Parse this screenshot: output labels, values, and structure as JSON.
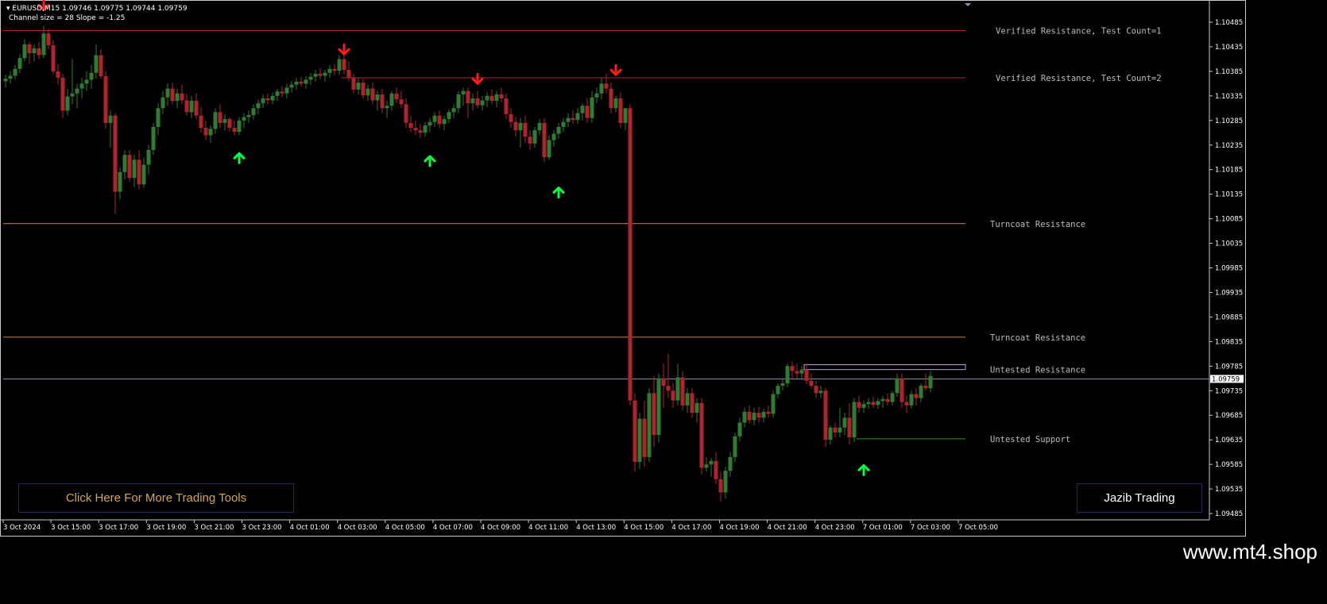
{
  "header": {
    "symbol_line": "EURUSD,M15  1.09746 1.09775 1.09744 1.09759",
    "channel_line": "Channel size = 28 Slope = -1.25"
  },
  "buttons": {
    "tools": "Click Here For More Trading Tools",
    "brand": "Jazib Trading"
  },
  "watermark": "www.mt4.shop",
  "colors": {
    "background": "#000000",
    "bull": "#2e7d32",
    "bear": "#b0232f",
    "arrow_up": "#00ff3c",
    "arrow_down": "#ff1a1a",
    "verified_resistance": "#b0232f",
    "turncoat": "#c8844a",
    "untested_resistance": "#b9a3d8",
    "untested_support": "#3a8a3a",
    "bid_line": "#8892b0"
  },
  "chart_data": {
    "type": "candlestick",
    "symbol": "EURUSD",
    "timeframe": "M15",
    "current_price": "1.09759",
    "y_ticks": [
      "1.10485",
      "1.10435",
      "1.10385",
      "1.10335",
      "1.10285",
      "1.10235",
      "1.10185",
      "1.10135",
      "1.10085",
      "1.10035",
      "1.09985",
      "1.09935",
      "1.09885",
      "1.09835",
      "1.09785",
      "1.09735",
      "1.09685",
      "1.09635",
      "1.09585",
      "1.09535",
      "1.09485"
    ],
    "x_ticks": [
      "3 Oct 2024",
      "3 Oct 15:00",
      "3 Oct 17:00",
      "3 Oct 19:00",
      "3 Oct 21:00",
      "3 Oct 23:00",
      "4 Oct 01:00",
      "4 Oct 03:00",
      "4 Oct 05:00",
      "4 Oct 07:00",
      "4 Oct 09:00",
      "4 Oct 11:00",
      "4 Oct 13:00",
      "4 Oct 15:00",
      "4 Oct 17:00",
      "4 Oct 19:00",
      "4 Oct 21:00",
      "4 Oct 23:00",
      "7 Oct 01:00",
      "7 Oct 03:00",
      "7 Oct 05:00"
    ],
    "zones": [
      {
        "label": "Verified Resistance, Test Count=1",
        "price": 1.10468,
        "kind": "verified",
        "start_bar": 0
      },
      {
        "label": "Verified Resistance, Test Count=2",
        "price": 1.10372,
        "kind": "verified",
        "start_bar": 71
      },
      {
        "label": "Turncoat Resistance",
        "price": 1.10075,
        "kind": "turncoat",
        "start_bar": 0
      },
      {
        "label": "Turncoat Resistance",
        "price": 1.09844,
        "kind": "turncoat",
        "start_bar": 0
      },
      {
        "label": "Untested Resistance",
        "price": 1.09778,
        "kind": "untested_res",
        "start_bar": 168,
        "top": 1.09788,
        "bottom": 1.09778
      },
      {
        "label": "Untested Support",
        "price": 1.09637,
        "kind": "untested_sup",
        "start_bar": 179
      }
    ],
    "arrows": [
      {
        "bar": 8,
        "dir": "down",
        "price": 1.1051
      },
      {
        "bar": 49,
        "dir": "up",
        "price": 1.10218
      },
      {
        "bar": 71,
        "dir": "down",
        "price": 1.1042
      },
      {
        "bar": 89,
        "dir": "up",
        "price": 1.10212
      },
      {
        "bar": 99,
        "dir": "down",
        "price": 1.1036
      },
      {
        "bar": 116,
        "dir": "up",
        "price": 1.10148
      },
      {
        "bar": 128,
        "dir": "down",
        "price": 1.10378
      },
      {
        "bar": 180,
        "dir": "up",
        "price": 1.09583
      }
    ],
    "candles": [
      [
        1.10365,
        1.10378,
        1.10352,
        1.1037
      ],
      [
        1.1037,
        1.10385,
        1.1036,
        1.10376
      ],
      [
        1.10376,
        1.10398,
        1.10368,
        1.1039
      ],
      [
        1.1039,
        1.1042,
        1.10382,
        1.10412
      ],
      [
        1.10412,
        1.1045,
        1.10405,
        1.1044
      ],
      [
        1.1044,
        1.10445,
        1.104,
        1.10422
      ],
      [
        1.10422,
        1.1044,
        1.10405,
        1.10432
      ],
      [
        1.10432,
        1.10445,
        1.1041,
        1.10418
      ],
      [
        1.10418,
        1.10478,
        1.10412,
        1.10462
      ],
      [
        1.10462,
        1.10472,
        1.1043,
        1.10438
      ],
      [
        1.10438,
        1.10448,
        1.1038,
        1.10385
      ],
      [
        1.10385,
        1.104,
        1.10358,
        1.10372
      ],
      [
        1.10372,
        1.1038,
        1.1029,
        1.10305
      ],
      [
        1.10305,
        1.1035,
        1.10295,
        1.10334
      ],
      [
        1.10334,
        1.1041,
        1.10318,
        1.1034
      ],
      [
        1.1034,
        1.1036,
        1.1031,
        1.1035
      ],
      [
        1.1035,
        1.10372,
        1.1033,
        1.1036
      ],
      [
        1.1036,
        1.10385,
        1.10345,
        1.10368
      ],
      [
        1.10368,
        1.10398,
        1.1035,
        1.10382
      ],
      [
        1.10382,
        1.1044,
        1.1037,
        1.10418
      ],
      [
        1.10418,
        1.1043,
        1.1037,
        1.10375
      ],
      [
        1.10375,
        1.10385,
        1.10268,
        1.1028
      ],
      [
        1.1028,
        1.10305,
        1.1023,
        1.10295
      ],
      [
        1.10295,
        1.103,
        1.10095,
        1.1014
      ],
      [
        1.1014,
        1.1019,
        1.10125,
        1.1018
      ],
      [
        1.1018,
        1.10225,
        1.10165,
        1.10215
      ],
      [
        1.10215,
        1.10225,
        1.1016,
        1.10168
      ],
      [
        1.10168,
        1.10215,
        1.1015,
        1.10205
      ],
      [
        1.10205,
        1.10225,
        1.10145,
        1.10155
      ],
      [
        1.10155,
        1.1021,
        1.10148,
        1.10195
      ],
      [
        1.10195,
        1.10235,
        1.10175,
        1.10225
      ],
      [
        1.10225,
        1.1028,
        1.10215,
        1.10272
      ],
      [
        1.10272,
        1.1032,
        1.10255,
        1.1031
      ],
      [
        1.1031,
        1.10345,
        1.10298,
        1.10332
      ],
      [
        1.10332,
        1.1036,
        1.10315,
        1.1035
      ],
      [
        1.1035,
        1.10362,
        1.10318,
        1.10325
      ],
      [
        1.10325,
        1.1035,
        1.1031,
        1.1034
      ],
      [
        1.1034,
        1.10358,
        1.10318,
        1.10326
      ],
      [
        1.10326,
        1.1034,
        1.10295,
        1.10302
      ],
      [
        1.10302,
        1.10335,
        1.1029,
        1.10325
      ],
      [
        1.10325,
        1.1034,
        1.10288,
        1.10295
      ],
      [
        1.10295,
        1.10312,
        1.1026,
        1.1027
      ],
      [
        1.1027,
        1.10285,
        1.10245,
        1.10255
      ],
      [
        1.10255,
        1.10275,
        1.1024,
        1.10268
      ],
      [
        1.10268,
        1.1031,
        1.10258,
        1.10302
      ],
      [
        1.10302,
        1.10318,
        1.1027,
        1.1028
      ],
      [
        1.1028,
        1.10298,
        1.10265,
        1.10288
      ],
      [
        1.10288,
        1.10292,
        1.10262,
        1.1027
      ],
      [
        1.1027,
        1.10285,
        1.10255,
        1.10262
      ],
      [
        1.10262,
        1.10292,
        1.10255,
        1.10285
      ],
      [
        1.10285,
        1.103,
        1.1027,
        1.10292
      ],
      [
        1.10292,
        1.10305,
        1.1028,
        1.10296
      ],
      [
        1.10296,
        1.10318,
        1.10288,
        1.1031
      ],
      [
        1.1031,
        1.10328,
        1.10298,
        1.1032
      ],
      [
        1.1032,
        1.10338,
        1.1031,
        1.1033
      ],
      [
        1.1033,
        1.1034,
        1.10318,
        1.10326
      ],
      [
        1.10326,
        1.10342,
        1.10318,
        1.10335
      ],
      [
        1.10335,
        1.1035,
        1.10325,
        1.10344
      ],
      [
        1.10344,
        1.10355,
        1.10332,
        1.1034
      ],
      [
        1.1034,
        1.1036,
        1.1033,
        1.10352
      ],
      [
        1.10352,
        1.10365,
        1.10342,
        1.10358
      ],
      [
        1.10358,
        1.10372,
        1.10348,
        1.10364
      ],
      [
        1.10364,
        1.10374,
        1.10354,
        1.1036
      ],
      [
        1.1036,
        1.10375,
        1.1035,
        1.10368
      ],
      [
        1.10368,
        1.10382,
        1.10358,
        1.10374
      ],
      [
        1.10374,
        1.10388,
        1.10364,
        1.1038
      ],
      [
        1.1038,
        1.10392,
        1.10368,
        1.10376
      ],
      [
        1.10376,
        1.10388,
        1.10364,
        1.10382
      ],
      [
        1.10382,
        1.10398,
        1.10372,
        1.1039
      ],
      [
        1.1039,
        1.104,
        1.10378,
        1.10386
      ],
      [
        1.10386,
        1.10418,
        1.10378,
        1.1041
      ],
      [
        1.1041,
        1.10425,
        1.1038,
        1.10388
      ],
      [
        1.10388,
        1.10405,
        1.10365,
        1.10372
      ],
      [
        1.10372,
        1.1038,
        1.1034,
        1.10348
      ],
      [
        1.10348,
        1.10372,
        1.10338,
        1.10362
      ],
      [
        1.10362,
        1.1037,
        1.1033,
        1.10336
      ],
      [
        1.10336,
        1.10358,
        1.10325,
        1.1035
      ],
      [
        1.1035,
        1.10362,
        1.10318,
        1.10326
      ],
      [
        1.10326,
        1.10345,
        1.10305,
        1.10338
      ],
      [
        1.10338,
        1.1035,
        1.103,
        1.1031
      ],
      [
        1.1031,
        1.10325,
        1.1029,
        1.10315
      ],
      [
        1.10315,
        1.10345,
        1.10305,
        1.1034
      ],
      [
        1.1034,
        1.10352,
        1.1032,
        1.10328
      ],
      [
        1.10328,
        1.10345,
        1.1031,
        1.10318
      ],
      [
        1.10318,
        1.1033,
        1.1027,
        1.1028
      ],
      [
        1.1028,
        1.10295,
        1.10262,
        1.1027
      ],
      [
        1.1027,
        1.10285,
        1.10255,
        1.10265
      ],
      [
        1.10265,
        1.10278,
        1.1025,
        1.1026
      ],
      [
        1.1026,
        1.10282,
        1.10252,
        1.10275
      ],
      [
        1.10275,
        1.1029,
        1.10262,
        1.10282
      ],
      [
        1.10282,
        1.10302,
        1.10272,
        1.10295
      ],
      [
        1.10295,
        1.10305,
        1.1027,
        1.10278
      ],
      [
        1.10278,
        1.10295,
        1.10265,
        1.10288
      ],
      [
        1.10288,
        1.10308,
        1.1028,
        1.10302
      ],
      [
        1.10302,
        1.10318,
        1.1029,
        1.1031
      ],
      [
        1.1031,
        1.10345,
        1.103,
        1.10338
      ],
      [
        1.10338,
        1.10352,
        1.10315,
        1.10345
      ],
      [
        1.10345,
        1.10352,
        1.1029,
        1.1032
      ],
      [
        1.1032,
        1.1034,
        1.10305,
        1.1033
      ],
      [
        1.1033,
        1.10345,
        1.1031,
        1.10316
      ],
      [
        1.10316,
        1.10335,
        1.10305,
        1.10326
      ],
      [
        1.10326,
        1.10342,
        1.10312,
        1.10335
      ],
      [
        1.10335,
        1.10348,
        1.10318,
        1.10325
      ],
      [
        1.10325,
        1.10345,
        1.10312,
        1.10338
      ],
      [
        1.10338,
        1.10352,
        1.10322,
        1.1033
      ],
      [
        1.1033,
        1.1034,
        1.10288,
        1.10298
      ],
      [
        1.10298,
        1.1031,
        1.1027,
        1.10282
      ],
      [
        1.10282,
        1.10292,
        1.10252,
        1.10265
      ],
      [
        1.10265,
        1.1029,
        1.1023,
        1.1028
      ],
      [
        1.1028,
        1.10295,
        1.1024,
        1.10252
      ],
      [
        1.10252,
        1.10265,
        1.10225,
        1.10238
      ],
      [
        1.10238,
        1.10272,
        1.1023,
        1.10265
      ],
      [
        1.10265,
        1.10288,
        1.10255,
        1.1028
      ],
      [
        1.1028,
        1.1029,
        1.102,
        1.1021
      ],
      [
        1.1021,
        1.10255,
        1.10205,
        1.10245
      ],
      [
        1.10245,
        1.10265,
        1.10232,
        1.10258
      ],
      [
        1.10258,
        1.1028,
        1.10248,
        1.10272
      ],
      [
        1.10272,
        1.1029,
        1.10262,
        1.10282
      ],
      [
        1.10282,
        1.103,
        1.10272,
        1.1029
      ],
      [
        1.1029,
        1.10305,
        1.10278,
        1.10286
      ],
      [
        1.10286,
        1.1031,
        1.10278,
        1.103
      ],
      [
        1.103,
        1.1032,
        1.10285,
        1.10315
      ],
      [
        1.10315,
        1.1033,
        1.1028,
        1.1029
      ],
      [
        1.1029,
        1.10345,
        1.1028,
        1.10332
      ],
      [
        1.10332,
        1.10352,
        1.1032,
        1.1034
      ],
      [
        1.1034,
        1.10372,
        1.10328,
        1.1036
      ],
      [
        1.1036,
        1.1038,
        1.1034,
        1.1035
      ],
      [
        1.1035,
        1.10362,
        1.103,
        1.1031
      ],
      [
        1.1031,
        1.10335,
        1.10302,
        1.1033
      ],
      [
        1.1033,
        1.10342,
        1.1027,
        1.1028
      ],
      [
        1.1028,
        1.1029,
        1.10265,
        1.1031
      ],
      [
        1.1031,
        1.10318,
        1.09705,
        1.09715
      ],
      [
        1.09715,
        1.0973,
        1.0957,
        1.0959
      ],
      [
        1.0959,
        1.0969,
        1.09575,
        1.09678
      ],
      [
        1.09678,
        1.09715,
        1.0958,
        1.096
      ],
      [
        1.096,
        1.0974,
        1.0959,
        1.0973
      ],
      [
        1.0973,
        1.09765,
        1.0962,
        1.09645
      ],
      [
        1.09645,
        1.0977,
        1.0963,
        1.0976
      ],
      [
        1.0976,
        1.0979,
        1.097,
        1.09745
      ],
      [
        1.09745,
        1.0981,
        1.0972,
        1.09735
      ],
      [
        1.09735,
        1.0975,
        1.097,
        1.09715
      ],
      [
        1.09715,
        1.0979,
        1.09705,
        1.09762
      ],
      [
        1.09762,
        1.09775,
        1.09695,
        1.09705
      ],
      [
        1.09705,
        1.0974,
        1.0969,
        1.0973
      ],
      [
        1.0973,
        1.0974,
        1.0968,
        1.0969
      ],
      [
        1.0969,
        1.0972,
        1.0967,
        1.0971
      ],
      [
        1.0971,
        1.0972,
        1.09565,
        1.09578
      ],
      [
        1.09578,
        1.096,
        1.0957,
        1.09585
      ],
      [
        1.09585,
        1.09598,
        1.0956,
        1.09592
      ],
      [
        1.09592,
        1.0961,
        1.09545,
        1.09555
      ],
      [
        1.09555,
        1.0957,
        1.0951,
        1.09528
      ],
      [
        1.09528,
        1.0958,
        1.09515,
        1.09572
      ],
      [
        1.09572,
        1.0961,
        1.0956,
        1.096
      ],
      [
        1.096,
        1.0965,
        1.0959,
        1.09642
      ],
      [
        1.09642,
        1.0968,
        1.09632,
        1.0967
      ],
      [
        1.0967,
        1.097,
        1.0966,
        1.09692
      ],
      [
        1.09692,
        1.09705,
        1.09668,
        1.09675
      ],
      [
        1.09675,
        1.097,
        1.09665,
        1.0969
      ],
      [
        1.0969,
        1.09702,
        1.0967,
        1.0968
      ],
      [
        1.0968,
        1.09698,
        1.0967,
        1.09692
      ],
      [
        1.09692,
        1.09705,
        1.0968,
        1.09688
      ],
      [
        1.09688,
        1.09735,
        1.0968,
        1.09728
      ],
      [
        1.09728,
        1.0975,
        1.0972,
        1.09745
      ],
      [
        1.09745,
        1.09758,
        1.09735,
        1.0975
      ],
      [
        1.0975,
        1.0979,
        1.09742,
        1.09785
      ],
      [
        1.09785,
        1.09795,
        1.0976,
        1.09775
      ],
      [
        1.09775,
        1.0979,
        1.0976,
        1.0977
      ],
      [
        1.0977,
        1.09785,
        1.0976,
        1.09778
      ],
      [
        1.09778,
        1.0979,
        1.09748,
        1.09755
      ],
      [
        1.09755,
        1.0977,
        1.0974,
        1.09745
      ],
      [
        1.09745,
        1.09755,
        1.0972,
        1.0973
      ],
      [
        1.0973,
        1.09745,
        1.0972,
        1.09735
      ],
      [
        1.09735,
        1.0974,
        1.0962,
        1.09635
      ],
      [
        1.09635,
        1.09665,
        1.09625,
        1.0966
      ],
      [
        1.0966,
        1.0967,
        1.0964,
        1.0965
      ],
      [
        1.0965,
        1.097,
        1.0964,
        1.0966
      ],
      [
        1.0966,
        1.0969,
        1.09645,
        1.0968
      ],
      [
        1.0968,
        1.0971,
        1.09625,
        1.0964
      ],
      [
        1.0964,
        1.0972,
        1.0963,
        1.09712
      ],
      [
        1.09712,
        1.09725,
        1.0969,
        1.097
      ],
      [
        1.097,
        1.09715,
        1.0969,
        1.09708
      ],
      [
        1.09708,
        1.0972,
        1.09698,
        1.09712
      ],
      [
        1.09712,
        1.09722,
        1.097,
        1.09706
      ],
      [
        1.09706,
        1.0972,
        1.09698,
        1.09714
      ],
      [
        1.09714,
        1.09725,
        1.097,
        1.09718
      ],
      [
        1.09718,
        1.0973,
        1.09705,
        1.09712
      ],
      [
        1.09712,
        1.09735,
        1.09705,
        1.0973
      ],
      [
        1.0973,
        1.0977,
        1.09722,
        1.0976
      ],
      [
        1.0976,
        1.0977,
        1.097,
        1.09712
      ],
      [
        1.09712,
        1.09725,
        1.0969,
        1.09705
      ],
      [
        1.09705,
        1.09735,
        1.09698,
        1.09728
      ],
      [
        1.09728,
        1.0974,
        1.09705,
        1.0972
      ],
      [
        1.0972,
        1.0975,
        1.09712,
        1.09745
      ],
      [
        1.09745,
        1.0977,
        1.09735,
        1.0974
      ],
      [
        1.0974,
        1.09775,
        1.09732,
        1.09765
      ]
    ]
  }
}
